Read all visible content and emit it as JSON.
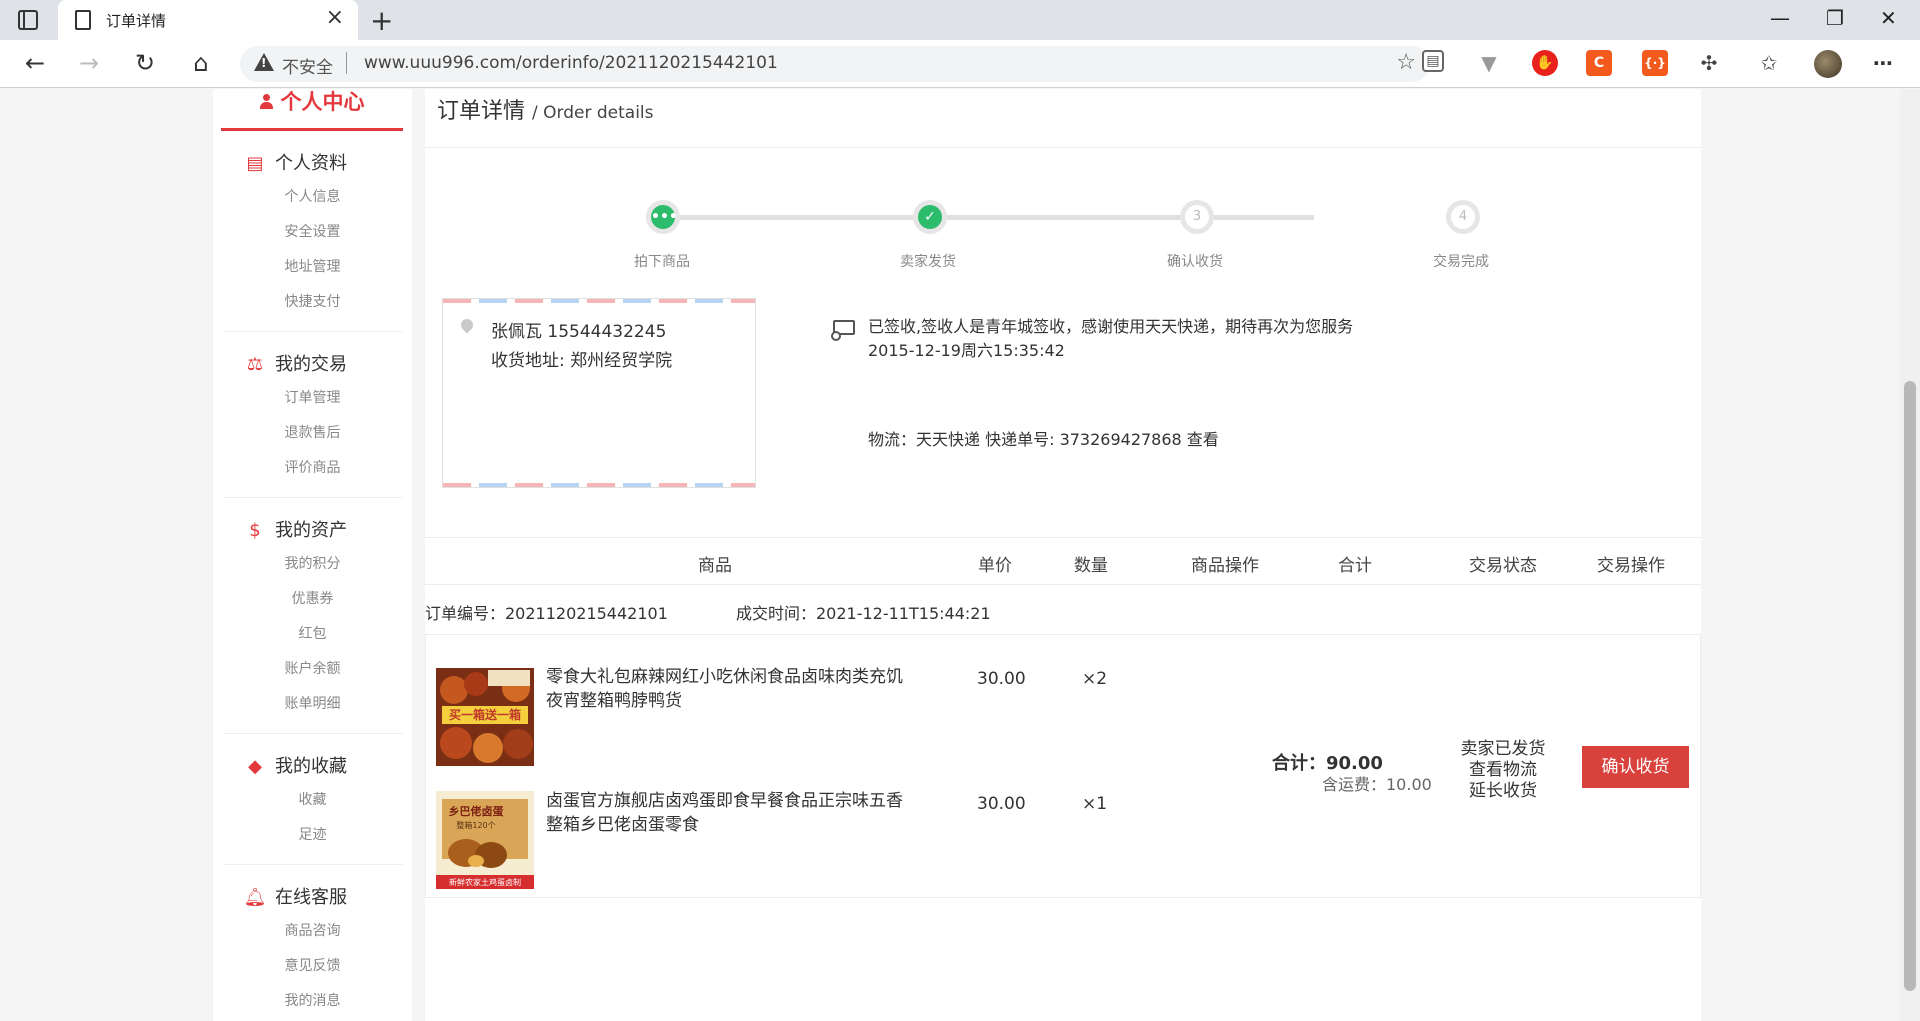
{
  "browser": {
    "tab_title": "订单详情",
    "insecure_label": "不安全",
    "url": "www.uuu996.com/orderinfo/2021120215442101"
  },
  "sidebar": {
    "header": "个人中心",
    "sections": [
      {
        "title": "个人资料",
        "icon": "profile-card-icon",
        "items": [
          "个人信息",
          "安全设置",
          "地址管理",
          "快捷支付"
        ]
      },
      {
        "title": "我的交易",
        "icon": "scale-icon",
        "items": [
          "订单管理",
          "退款售后",
          "评价商品"
        ]
      },
      {
        "title": "我的资产",
        "icon": "dollar-icon",
        "items": [
          "我的积分",
          "优惠券",
          "红包",
          "账户余额",
          "账单明细"
        ]
      },
      {
        "title": "我的收藏",
        "icon": "tags-icon",
        "items": [
          "收藏",
          "足迹"
        ]
      },
      {
        "title": "在线客服",
        "icon": "bell-icon",
        "items": [
          "商品咨询",
          "意见反馈",
          "我的消息"
        ]
      }
    ]
  },
  "page": {
    "title": "订单详情",
    "title_en": "/ Order details"
  },
  "progress": {
    "steps": [
      "拍下商品",
      "卖家发货",
      "确认收货",
      "交易完成"
    ],
    "step_marks": [
      "•••",
      "✓",
      "3",
      "4"
    ],
    "completed": 2
  },
  "address": {
    "name_phone": "张佩瓦 15544432245",
    "address": "收货地址:   郑州经贸学院"
  },
  "shipping": {
    "status": "已签收,签收人是青年城签收，感谢使用天天快递，期待再次为您服务",
    "time": "2015-12-19周六15:35:42",
    "logistics": "物流：天天快递 快递单号: 373269427868 查看"
  },
  "table": {
    "headers": [
      "商品",
      "单价",
      "数量",
      "商品操作",
      "合计",
      "交易状态",
      "交易操作"
    ]
  },
  "order": {
    "number": "订单编号：2021120215442101",
    "time": "成交时间：2021-12-11T15:44:21",
    "items": [
      {
        "name": "零食大礼包麻辣网红小吃休闲食品卤味肉类充饥夜宵整箱鸭脖鸭货",
        "price": "30.00",
        "qty": "×2",
        "image_text": "买一箱送一箱"
      },
      {
        "name": "卤蛋官方旗舰店卤鸡蛋即食早餐食品正宗味五香整箱乡巴佬卤蛋零食",
        "price": "30.00",
        "qty": "×1",
        "image_text": "乡巴佬卤蛋",
        "image_sub": "整箱120个",
        "image_footer": "新鲜农家土鸡蛋卤制"
      }
    ],
    "total": "合计：90.00",
    "shipping_fee": "含运费：10.00",
    "status_lines": [
      "卖家已发货",
      "查看物流",
      "延长收货"
    ],
    "action_button": "确认收货"
  },
  "colors": {
    "accent": "#e4393c",
    "success": "#2dbb6c",
    "button": "#d9423c"
  }
}
